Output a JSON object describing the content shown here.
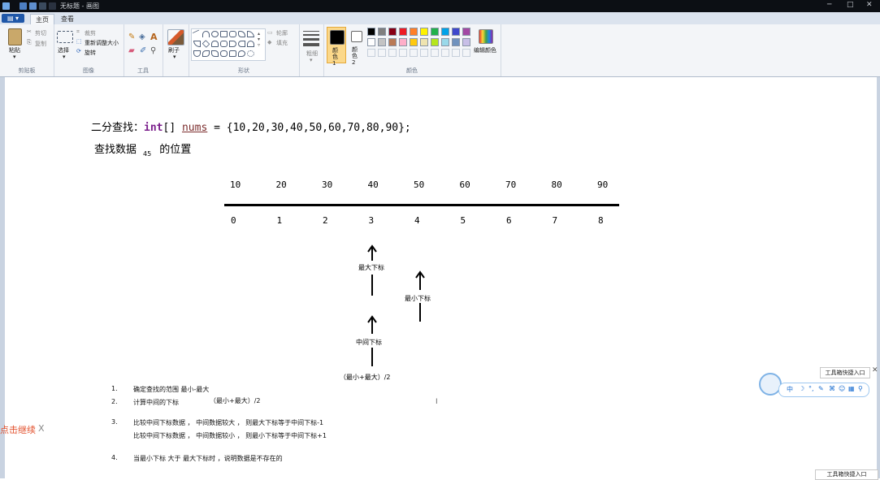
{
  "window": {
    "title": "无标题 - 画图",
    "controls": {
      "minimize": "─",
      "maximize": "□",
      "close": "✕"
    }
  },
  "tabs": {
    "app_menu": "▤ ▾",
    "home": "主页",
    "view": "查看"
  },
  "ribbon": {
    "clipboard": {
      "paste": "粘贴",
      "cut": "剪切",
      "copy": "复制",
      "group": "剪贴板"
    },
    "image": {
      "select": "选择",
      "crop": "裁剪",
      "resize": "重新调整大小",
      "rotate": "旋转",
      "group": "图像"
    },
    "tools": {
      "group": "工具",
      "text_tool": "A"
    },
    "brushes": {
      "label": "刷子"
    },
    "shapes": {
      "outline": "轮廓",
      "fill": "填充",
      "group": "形状"
    },
    "size": {
      "label": "粗细"
    },
    "colors": {
      "color1": "颜色 1",
      "color2": "颜色 2",
      "edit": "编辑颜色",
      "group": "颜色",
      "palette": [
        "#000000",
        "#7f7f7f",
        "#880015",
        "#ed1c24",
        "#ff7f27",
        "#fff200",
        "#22b14c",
        "#00a2e8",
        "#3f48cc",
        "#a349a4",
        "#ffffff",
        "#c3c3c3",
        "#b97a57",
        "#ffaec9",
        "#ffc90e",
        "#efe4b0",
        "#b5e61d",
        "#99d9ea",
        "#7092be",
        "#c8bfe7"
      ]
    }
  },
  "canvas": {
    "heading_prefix": "二分查找：",
    "heading_keyword": "int",
    "heading_brackets": "[] ",
    "heading_var": "nums",
    "heading_rest": " = {10,20,30,40,50,60,70,80,90};",
    "sub_prefix": "查找数据",
    "sub_value": "45",
    "sub_suffix": "的位置",
    "values": [
      "10",
      "20",
      "30",
      "40",
      "50",
      "60",
      "70",
      "80",
      "90"
    ],
    "indices": [
      "0",
      "1",
      "2",
      "3",
      "4",
      "5",
      "6",
      "7",
      "8"
    ],
    "label_max": "最大下标",
    "label_min": "最小下标",
    "label_mid": "中间下标",
    "formula": "（最小+最大）/2",
    "notes": [
      {
        "num": "1.",
        "text": "确定查找的范围  最小-最大"
      },
      {
        "num": "2.",
        "text": "计算中间的下标",
        "extra": "（最小+最大）/2"
      },
      {
        "num": "3.",
        "text": "比较中间下标数据 ， 中间数据较大 ， 则最大下标等于中间下标-1"
      },
      {
        "num": "",
        "text": "比较中间下标数据 ， 中间数据较小 ， 则最小下标等于中间下标+1"
      },
      {
        "num": "4.",
        "text": "当最小下标  大于 最大下标时 ，说明数据是不存在的"
      }
    ]
  },
  "overlays": {
    "continue": "点击继续",
    "continue_close": "X",
    "ime_tip": "工具箱快捷入口",
    "ime_close": "✕",
    "ime_chars": [
      "中",
      "☽",
      "°,",
      "✎",
      "⌘",
      "☺",
      "▦",
      "⚲"
    ],
    "bottom_tip": "工具箱快捷入口"
  }
}
